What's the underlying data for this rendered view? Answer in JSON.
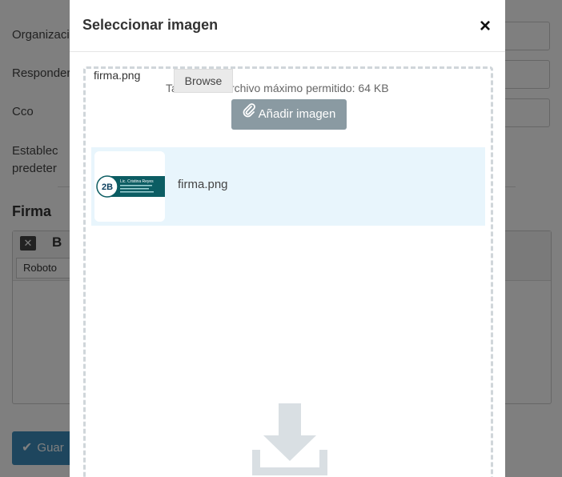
{
  "background": {
    "labels": {
      "organization": "Organizaci",
      "responder": "Responder",
      "cco": "Cco",
      "establish_line1": "Establec",
      "establish_line2": "predeter"
    },
    "section_title": "Firma",
    "editor": {
      "bold_label": "B",
      "font_value": "Roboto"
    },
    "save_label": "Guar"
  },
  "modal": {
    "title": "Seleccionar imagen",
    "close_symbol": "×",
    "file_input_value": "firma.png",
    "browse_label": "Browse",
    "max_size_text": "Tamaño de archivo máximo permitido: 64 KB",
    "add_image_label": "Añadir imagen",
    "files": [
      {
        "name": "firma.png",
        "thumb_name": "Lic. Cristina Reyes",
        "thumb_logo": "2B"
      }
    ]
  },
  "colors": {
    "accent": "#3c8dbc",
    "add_button": "#8a9aa2",
    "row_highlight": "#e8f5fc",
    "thumb_banner": "#0c5d63",
    "dropzone_border": "#d0d6da"
  },
  "icons": {
    "close": "close-icon",
    "clip": "paperclip-icon",
    "download": "download-icon",
    "check": "check-icon"
  }
}
